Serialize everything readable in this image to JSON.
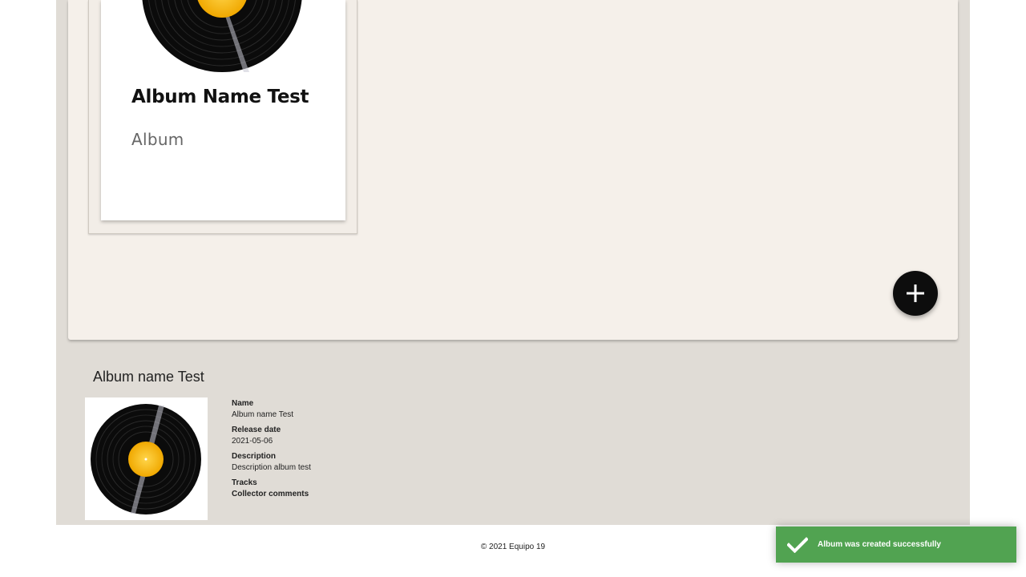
{
  "album_card": {
    "title": "Album Name Test",
    "subtitle": "Album",
    "cover": "vinyl-record-icon"
  },
  "add_button": {
    "icon": "plus-icon"
  },
  "album_detail": {
    "heading": "Album name Test",
    "cover": "vinyl-record-icon",
    "fields": [
      {
        "label": "Name",
        "value": "Album name Test"
      },
      {
        "label": "Release date",
        "value": "2021-05-06"
      },
      {
        "label": "Description",
        "value": "Description album test"
      },
      {
        "label": "Tracks",
        "value": ""
      },
      {
        "label": "Collector comments",
        "value": ""
      }
    ]
  },
  "footer": {
    "copyright": "© 2021 Equipo 19"
  },
  "toast": {
    "message": "Album was created successfully",
    "icon": "checkmark-icon",
    "color": "#51a351"
  },
  "colors": {
    "outer_background": "#e0dcd6",
    "panel_background": "#f5f0ea",
    "fab_background": "#0d0d0d",
    "record_label": "#f5b312"
  }
}
